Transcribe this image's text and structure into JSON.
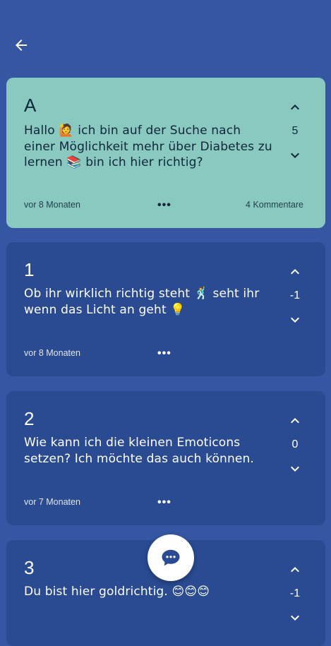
{
  "question": {
    "author_initial": "A",
    "text": "Hallo 🙋 ich bin auf der Suche nach\neiner Möglichkeit mehr über Diabetes zu\nlernen 📚 bin ich hier richtig?",
    "votes": "5",
    "time": "vor 8 Monaten",
    "more": "•••",
    "comments": "4 Kommentare"
  },
  "answers": [
    {
      "number": "1",
      "text": "Ob ihr wirklich richtig steht 🕺 seht ihr\nwenn das Licht an geht 💡",
      "votes": "-1",
      "time": "vor 8 Monaten",
      "more": "•••"
    },
    {
      "number": "2",
      "text": "Wie kann ich die kleinen  Emoticons\nsetzen? Ich möchte das auch können.",
      "votes": "0",
      "time": "vor 7 Monaten",
      "more": "•••"
    },
    {
      "number": "3",
      "text": "Du bist hier goldrichtig. 😊😊😊",
      "votes": "-1",
      "time": "",
      "more": ""
    }
  ],
  "icons": {
    "back": "arrow-left-icon",
    "upvote": "chevron-up-icon",
    "downvote": "chevron-down-icon",
    "fab": "chat-bubble-icon"
  },
  "colors": {
    "background": "#3556a3",
    "question_card": "#89c9c0",
    "answer_card": "#2a4b92",
    "fab": "#ffffff",
    "fab_icon": "#2a4b92"
  }
}
